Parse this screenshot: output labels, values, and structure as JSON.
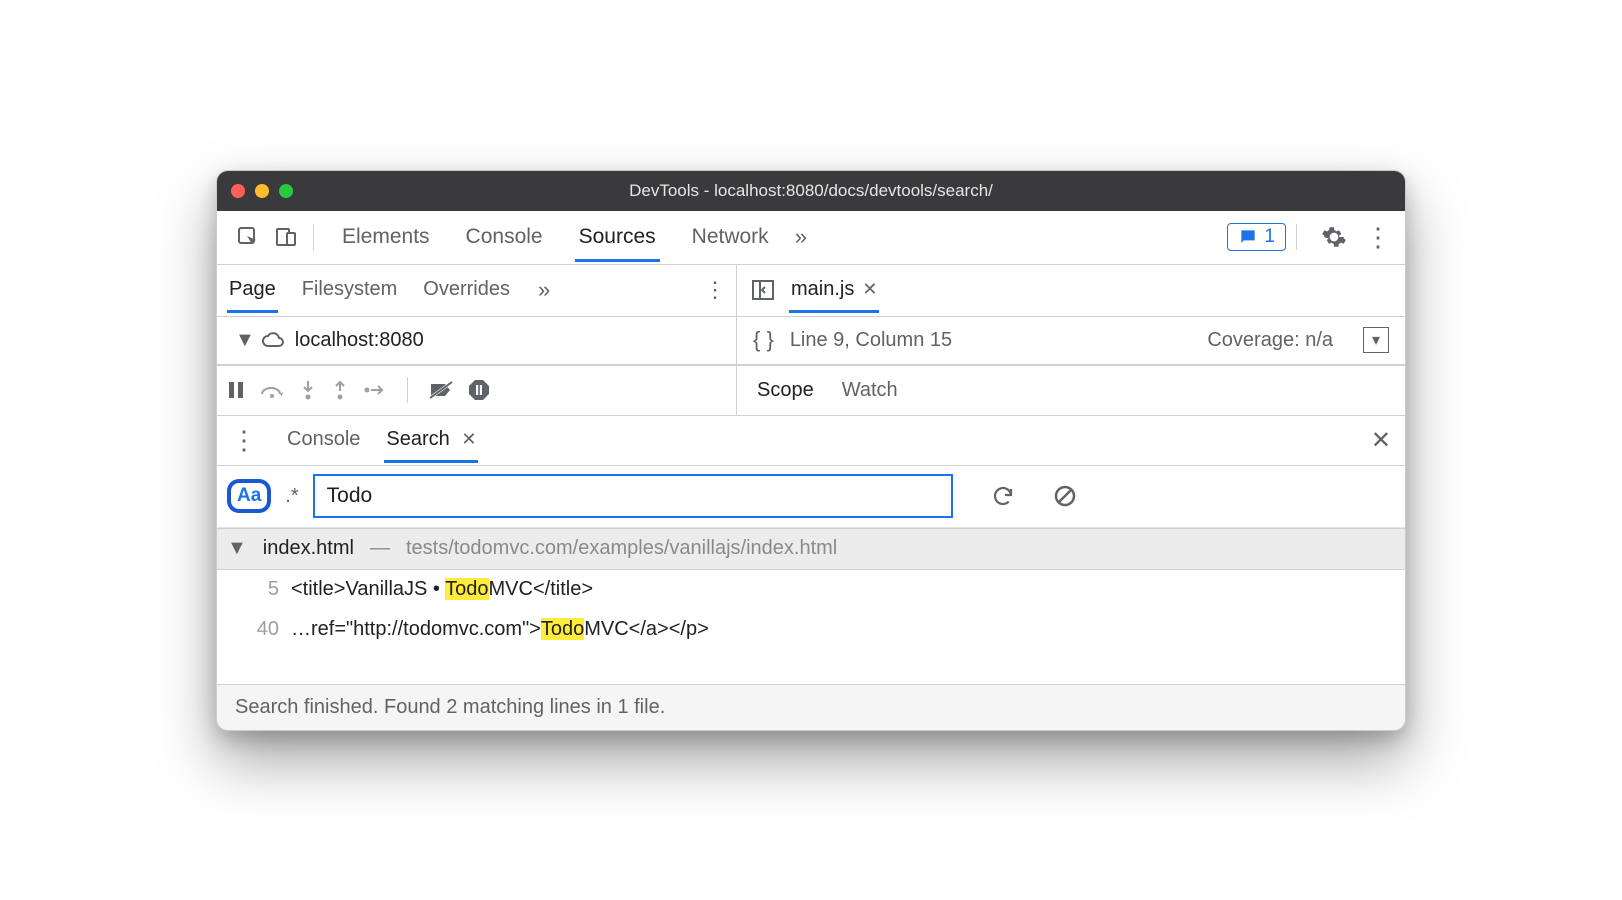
{
  "window_title": "DevTools - localhost:8080/docs/devtools/search/",
  "main_tabs": {
    "elements": "Elements",
    "console": "Console",
    "sources": "Sources",
    "network": "Network"
  },
  "feedback_count": "1",
  "sources_subtabs": {
    "page": "Page",
    "filesystem": "Filesystem",
    "overrides": "Overrides"
  },
  "tree_host": "localhost:8080",
  "editor": {
    "file_name": "main.js",
    "status": "Line 9, Column 15",
    "coverage": "Coverage: n/a"
  },
  "debug_tabs": {
    "scope": "Scope",
    "watch": "Watch"
  },
  "drawer": {
    "console": "Console",
    "search": "Search"
  },
  "search": {
    "case_label": "Aa",
    "regex_label": ".*",
    "query": "Todo"
  },
  "results": {
    "file_name": "index.html",
    "file_path": "tests/todomvc.com/examples/vanillajs/index.html",
    "lines": [
      {
        "n": "5",
        "pre": "<title>VanillaJS • ",
        "match": "Todo",
        "post": "MVC</title>"
      },
      {
        "n": "40",
        "pre": "…ref=\"http://todomvc.com\">",
        "match": "Todo",
        "post": "MVC</a></p>"
      }
    ]
  },
  "footer_status": "Search finished.  Found 2 matching lines in 1 file."
}
